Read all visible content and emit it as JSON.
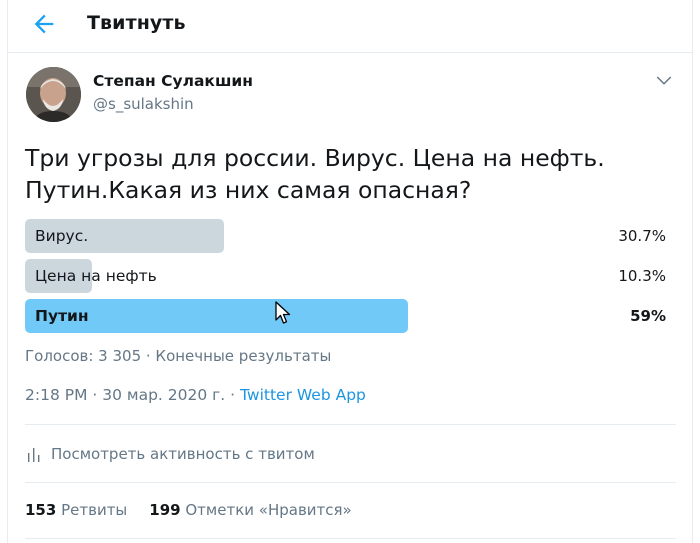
{
  "header": {
    "title": "Твитнуть",
    "back_icon": "arrow-left-icon",
    "accent": "#1da1f2"
  },
  "author": {
    "name": "Степан Сулакшин",
    "handle": "@s_sulakshin",
    "menu_icon": "chevron-down-icon"
  },
  "tweet": {
    "text": "Три угрозы для россии. Вирус. Цена на нефть. Путин.Какая из них самая опасная?"
  },
  "poll": {
    "options": [
      {
        "label": "Вирус.",
        "percent_text": "30.7%",
        "percent": 30.7,
        "winner": false
      },
      {
        "label": "Цена на нефть",
        "percent_text": "10.3%",
        "percent": 10.3,
        "winner": false
      },
      {
        "label": "Путин",
        "percent_text": "59%",
        "percent": 59,
        "winner": true
      }
    ],
    "meta": "Голосов: 3 305 · Конечные результаты",
    "bar_color": "#ccd6dd",
    "winner_bar_color": "#71c9f8"
  },
  "timestamp": {
    "text": "2:18 PM · 30 мар. 2020 г. · ",
    "source": "Twitter Web App",
    "source_color": "#1b95e0"
  },
  "activity": {
    "label": "Посмотреть активность с твитом",
    "icon": "analytics-bars-icon"
  },
  "stats": {
    "retweets_count": "153",
    "retweets_label": "Ретвиты",
    "likes_count": "199",
    "likes_label": "Отметки «Нравится»"
  }
}
